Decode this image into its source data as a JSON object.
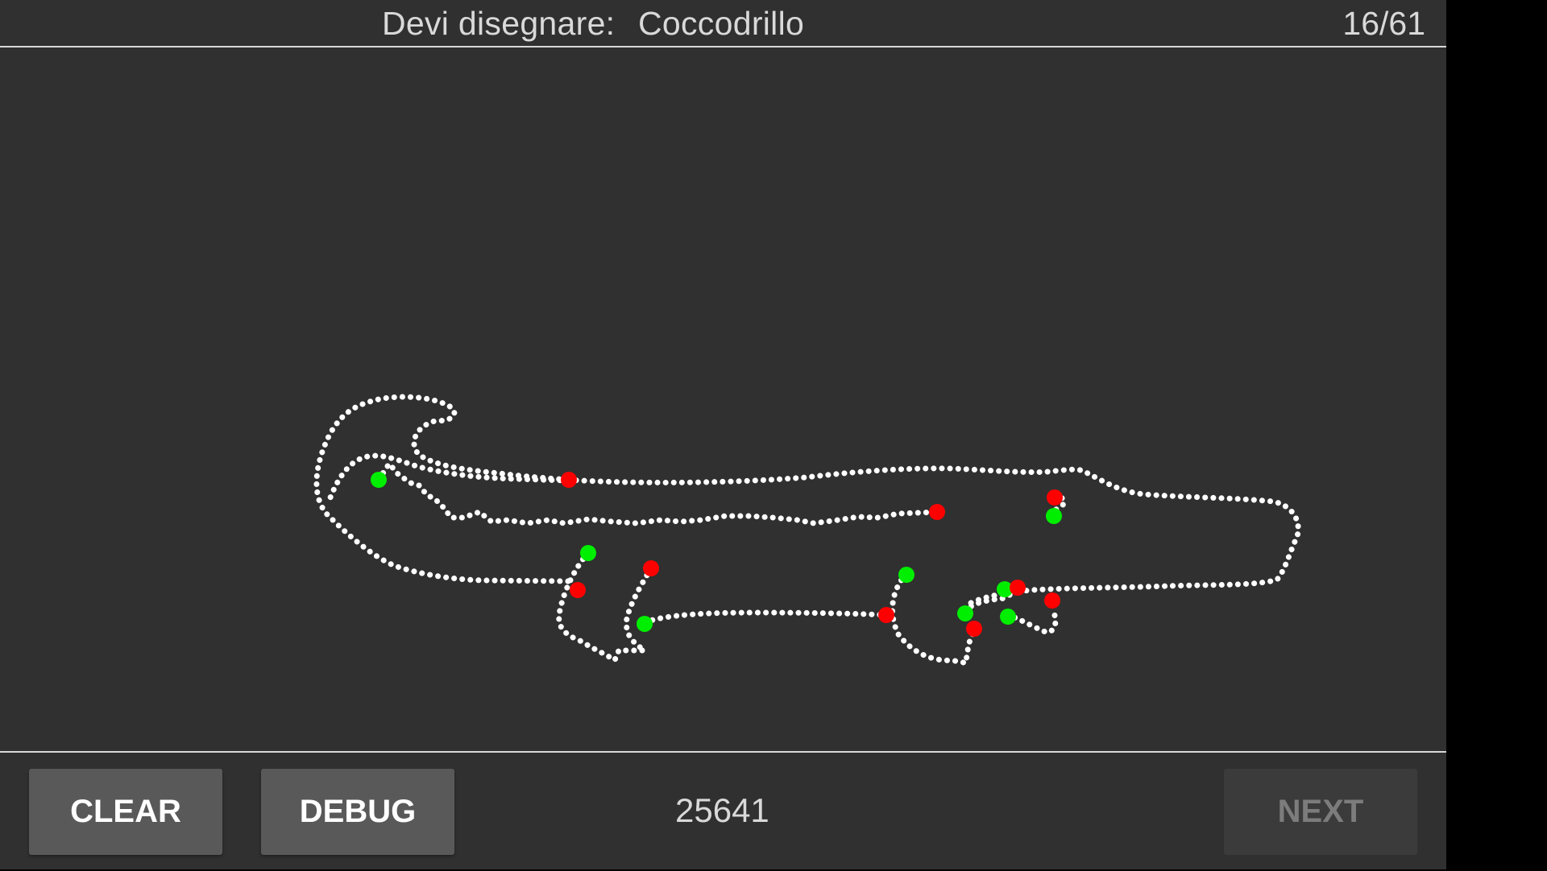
{
  "header": {
    "prompt_label": "Devi disegnare:",
    "prompt_word": "Coccodrillo",
    "counter": "16/61"
  },
  "canvas": {
    "stroke_color": "#ffffff",
    "start_marker_color": "#00ee00",
    "end_marker_color": "#ff0000",
    "background": "#303030"
  },
  "footer": {
    "clear_label": "CLEAR",
    "debug_label": "DEBUG",
    "score": "25641",
    "next_label": "NEXT"
  }
}
